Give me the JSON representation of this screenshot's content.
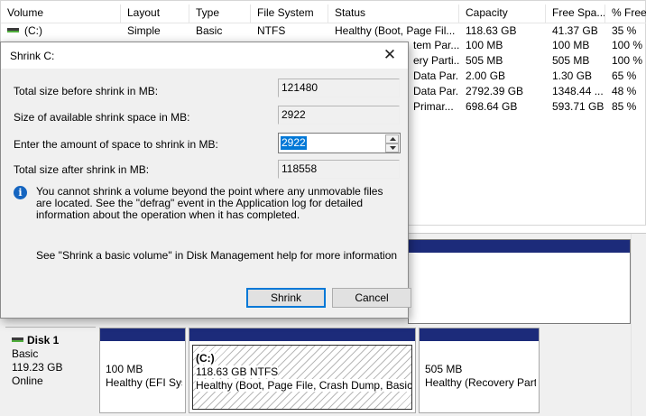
{
  "table": {
    "columns": [
      "Volume",
      "Layout",
      "Type",
      "File System",
      "Status",
      "Capacity",
      "Free Spa...",
      "% Free"
    ],
    "rows": [
      [
        "(C:)",
        "Simple",
        "Basic",
        "NTFS",
        "Healthy (Boot, Page Fil...",
        "118.63 GB",
        "41.37 GB",
        "35 %"
      ],
      [
        "",
        "",
        "",
        "",
        "tem Par...",
        "100 MB",
        "100 MB",
        "100 %"
      ],
      [
        "",
        "",
        "",
        "",
        "ery Parti...",
        "505 MB",
        "505 MB",
        "100 %"
      ],
      [
        "",
        "",
        "",
        "",
        "Data Par...",
        "2.00 GB",
        "1.30 GB",
        "65 %"
      ],
      [
        "",
        "",
        "",
        "",
        "Data Par...",
        "2792.39 GB",
        "1348.44 ...",
        "48 %"
      ],
      [
        "",
        "",
        "",
        "",
        "Primar...",
        "698.64 GB",
        "593.71 GB",
        "85 %"
      ]
    ]
  },
  "dialog": {
    "title": "Shrink C:",
    "close_glyph": "✕",
    "total_before_label": "Total size before shrink in MB:",
    "total_before_value": "121480",
    "available_label": "Size of available shrink space in MB:",
    "available_value": "2922",
    "amount_label": "Enter the amount of space to shrink in MB:",
    "amount_value": "2922",
    "total_after_label": "Total size after shrink in MB:",
    "total_after_value": "118558",
    "info_glyph": "i",
    "info_text": "You cannot shrink a volume beyond the point where any unmovable files are located. See the \"defrag\" event in the Application log for detailed information about the operation when it has completed.",
    "help_text": "See \"Shrink a basic volume\" in Disk Management help for more information",
    "shrink_label": "Shrink",
    "cancel_label": "Cancel"
  },
  "disk": {
    "name": "Disk 1",
    "type": "Basic",
    "size": "119.23 GB",
    "status": "Online",
    "partitions": [
      {
        "name": "",
        "size": "100 MB",
        "status": "Healthy (EFI System Partition)"
      },
      {
        "name": "(C:)",
        "size": "118.63 GB NTFS",
        "status": "Healthy (Boot, Page File, Crash Dump, Basic Data Partition)"
      },
      {
        "name": "",
        "size": "505 MB",
        "status": "Healthy (Recovery Partition)"
      }
    ]
  },
  "colors": {
    "partition_bar": "#1c2b7a",
    "selection": "#0078d7",
    "info_icon": "#1565c0"
  }
}
